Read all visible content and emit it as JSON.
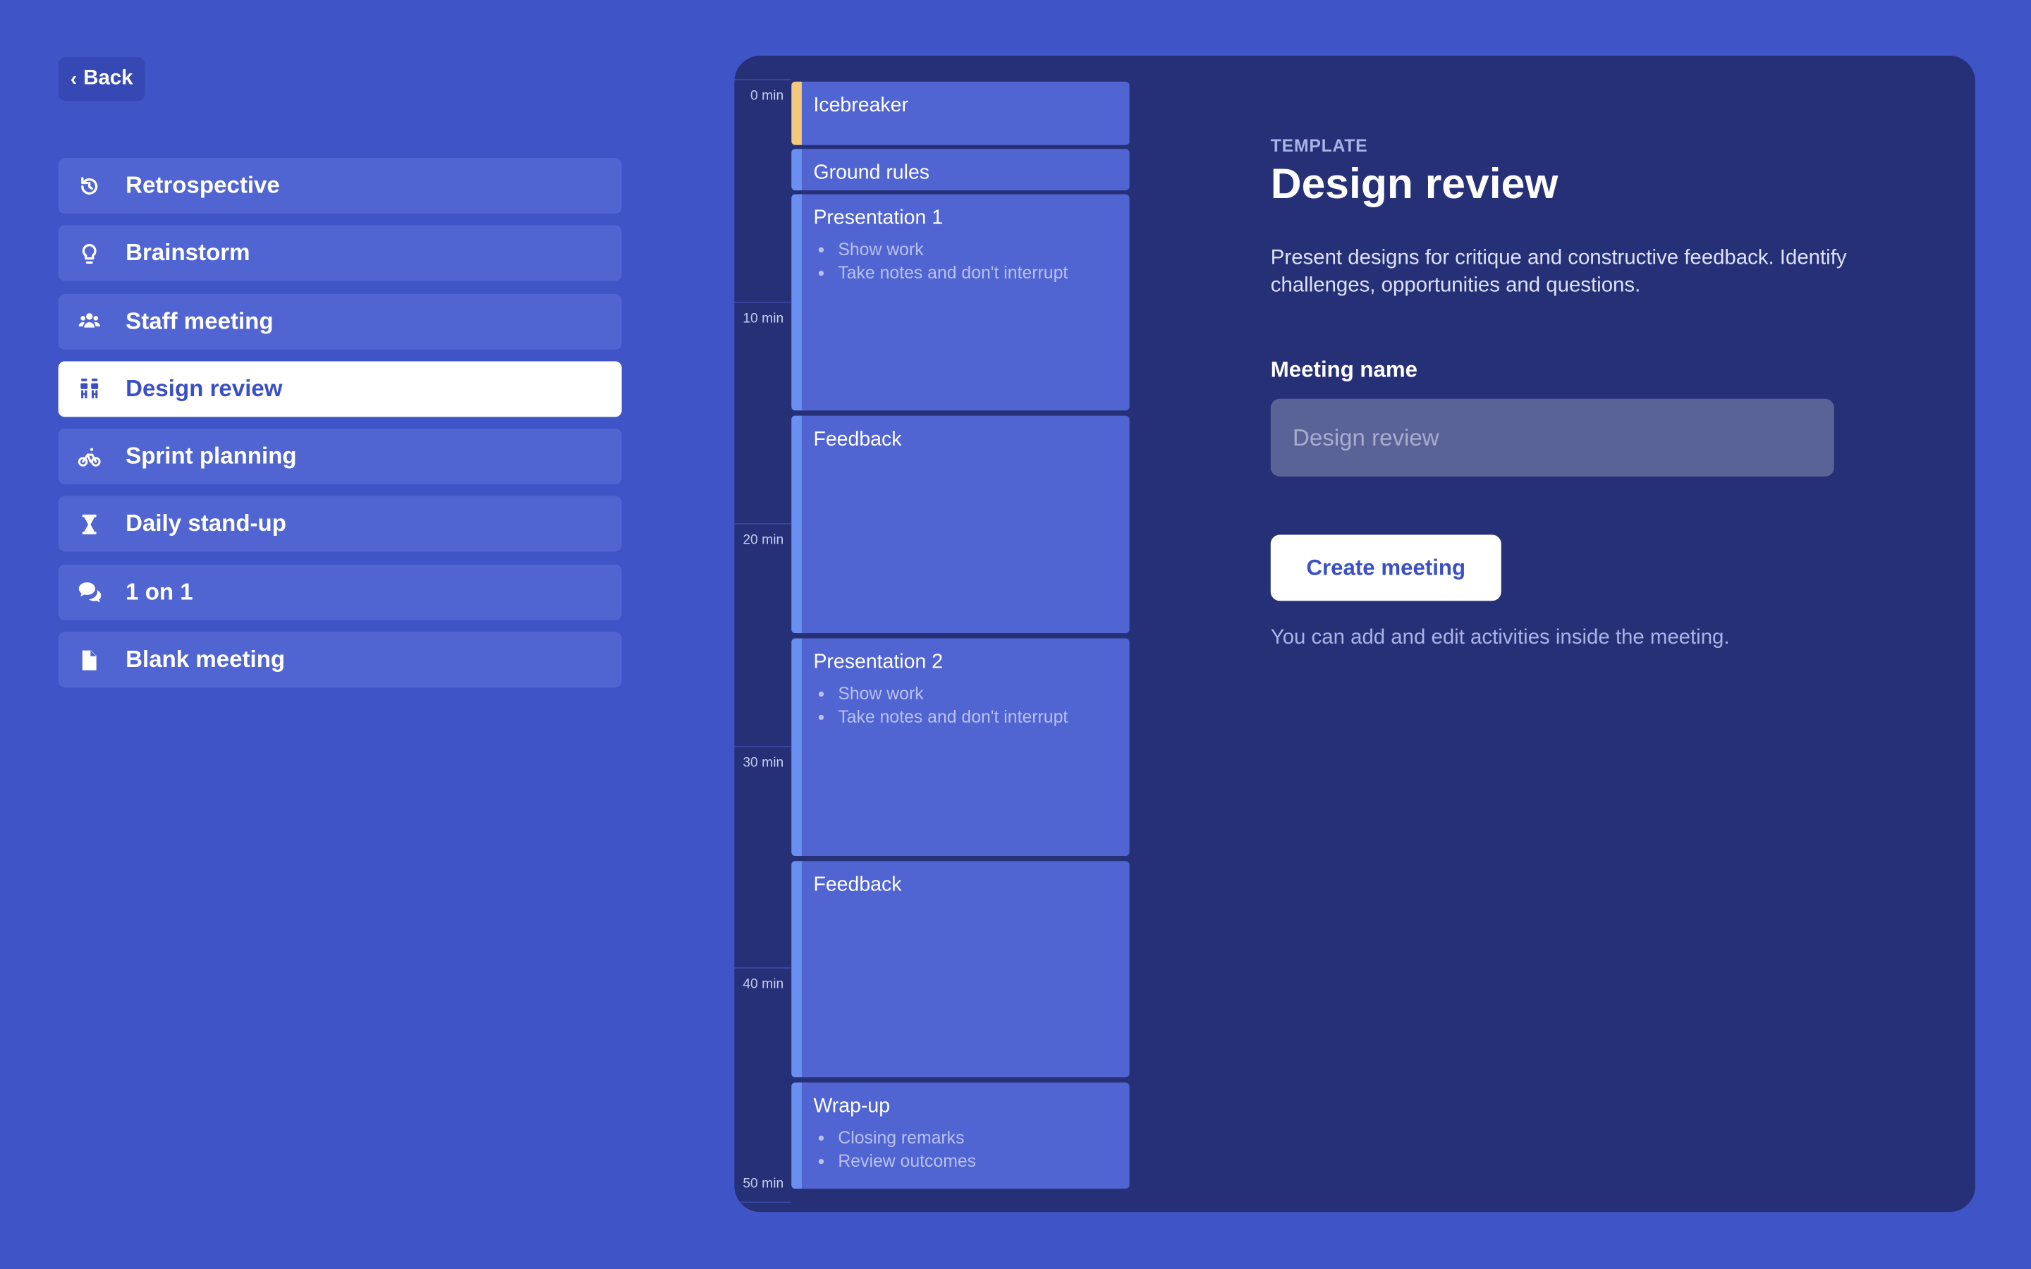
{
  "back": {
    "label": "Back"
  },
  "templates": [
    {
      "label": "Retrospective",
      "icon": "history-icon",
      "active": false
    },
    {
      "label": "Brainstorm",
      "icon": "lightbulb-icon",
      "active": false
    },
    {
      "label": "Staff meeting",
      "icon": "users-icon",
      "active": false
    },
    {
      "label": "Design review",
      "icon": "easel-icon",
      "active": true
    },
    {
      "label": "Sprint planning",
      "icon": "bicycle-icon",
      "active": false
    },
    {
      "label": "Daily stand-up",
      "icon": "hourglass-icon",
      "active": false
    },
    {
      "label": "1 on 1",
      "icon": "chat-bubbles-icon",
      "active": false
    },
    {
      "label": "Blank meeting",
      "icon": "document-icon",
      "active": false
    }
  ],
  "timeline": {
    "ticks": [
      "0 min",
      "10 min",
      "20 min",
      "30 min",
      "40 min",
      "50 min"
    ]
  },
  "activities": [
    {
      "title": "Icebreaker",
      "bullets": [],
      "accent": "#f2c97d"
    },
    {
      "title": "Ground rules",
      "bullets": [],
      "accent": "#6a8ff0"
    },
    {
      "title": "Presentation 1",
      "bullets": [
        "Show work",
        "Take notes and don't interrupt"
      ],
      "accent": "#6a8ff0"
    },
    {
      "title": "Feedback",
      "bullets": [],
      "accent": "#6a8ff0"
    },
    {
      "title": "Presentation 2",
      "bullets": [
        "Show work",
        "Take notes and don't interrupt"
      ],
      "accent": "#6a8ff0"
    },
    {
      "title": "Feedback",
      "bullets": [],
      "accent": "#6a8ff0"
    },
    {
      "title": "Wrap-up",
      "bullets": [
        "Closing remarks",
        "Review outcomes"
      ],
      "accent": "#6a8ff0"
    }
  ],
  "detail": {
    "eyebrow": "TEMPLATE",
    "title": "Design review",
    "description": "Present designs for critique and constructive feedback. Identify challenges, opportunities and questions.",
    "name_label": "Meeting name",
    "name_placeholder": "Design review",
    "name_value": "",
    "create_label": "Create meeting",
    "hint": "You can add and edit activities inside the meeting."
  },
  "colors": {
    "background": "#3f54c7",
    "panel": "#263077",
    "item": "#5064d2",
    "active_text": "#3a4fc4"
  }
}
